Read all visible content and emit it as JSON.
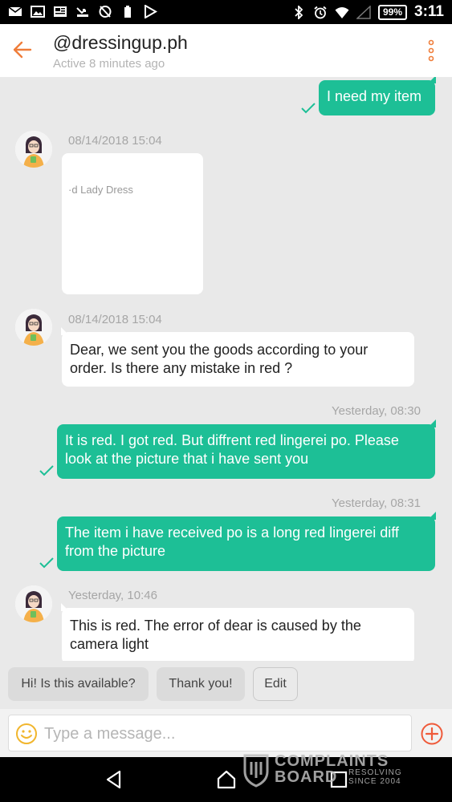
{
  "status_bar": {
    "battery": "99%",
    "time": "3:11",
    "left_icons": [
      "mail-icon",
      "image-icon",
      "news-icon",
      "missed-call-icon",
      "sync-off-icon",
      "battery-saver-icon",
      "play-store-icon"
    ],
    "right_icons": [
      "bluetooth-icon",
      "alarm-icon",
      "wifi-icon",
      "signal-icon"
    ]
  },
  "header": {
    "title": "@dressingup.ph",
    "status": "Active 8 minutes ago",
    "accent": "#ef7d3a"
  },
  "messages": [
    {
      "type": "outgoing",
      "text": "I need my item",
      "read": true
    },
    {
      "type": "incoming_product",
      "time": "08/14/2018 15:04",
      "product_title": "·d Lady Dress"
    },
    {
      "type": "incoming",
      "time": "08/14/2018 15:04",
      "lines": [
        "Dear, we sent you the goods according to your",
        "order. Is there any mistake in red ?"
      ]
    },
    {
      "type": "outgoing",
      "time": "Yesterday, 08:30",
      "lines": [
        "It is red. I got red. But diffrent red lingerei po. Please",
        "look at the picture that i have sent you"
      ],
      "read": true
    },
    {
      "type": "outgoing",
      "time": "Yesterday, 08:31",
      "lines": [
        "The item i have received po is a long red lingerei diff",
        "from the picture"
      ],
      "read": true
    },
    {
      "type": "incoming",
      "time": "Yesterday, 10:46",
      "lines": [
        "This is red. The error of dear is caused by the",
        "camera light"
      ]
    }
  ],
  "quick_replies": [
    "Hi! Is this available?",
    "Thank you!",
    "Edit"
  ],
  "composer": {
    "placeholder": "Type a message..."
  },
  "watermark": {
    "line1": "COMPLAINTS",
    "line2": "BOARD",
    "tag1": "RESOLVING",
    "tag2": "SINCE 2004"
  },
  "colors": {
    "outgoing_bubble": "#1dbf96",
    "incoming_bubble": "#ffffff",
    "chat_background": "#e9e9e9",
    "accent": "#ef7d3a"
  }
}
